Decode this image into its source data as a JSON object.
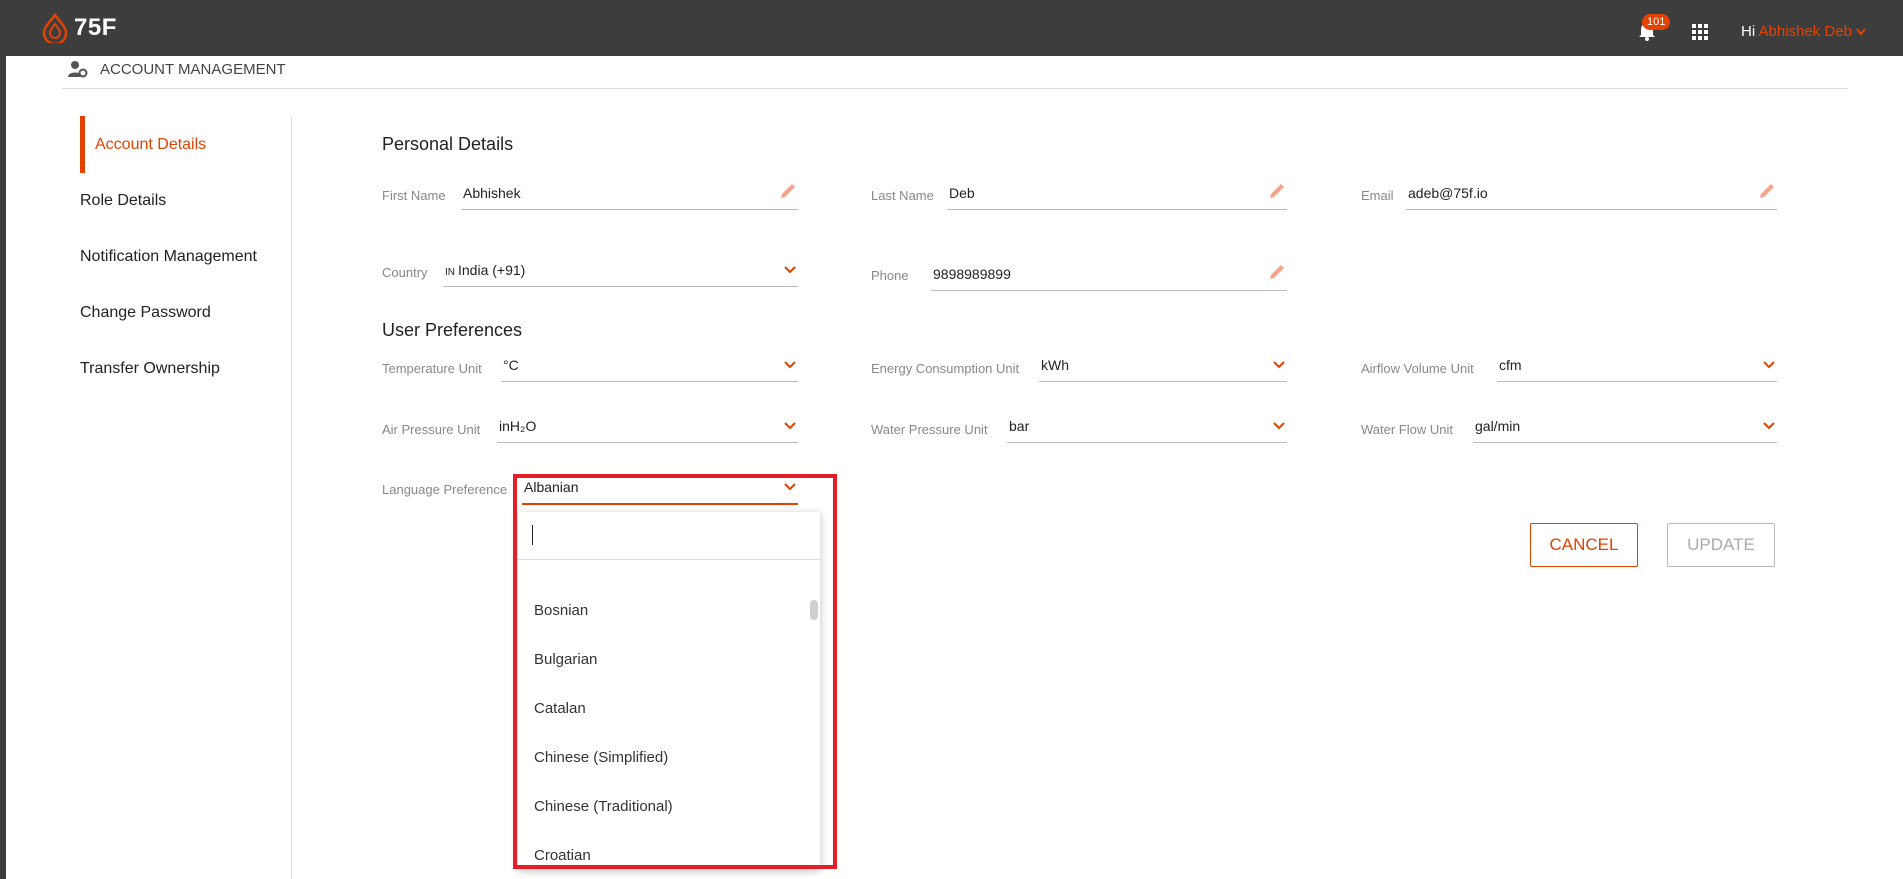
{
  "app": {
    "logo_text": "75F"
  },
  "topbar": {
    "notification_count": "101",
    "greeting": "Hi",
    "user_name": "Abhishek Deb"
  },
  "page": {
    "section_title": "ACCOUNT MANAGEMENT"
  },
  "sidebar": {
    "items": [
      {
        "label": "Account Details",
        "active": true
      },
      {
        "label": "Role Details"
      },
      {
        "label": "Notification Management"
      },
      {
        "label": "Change Password"
      },
      {
        "label": "Transfer Ownership"
      }
    ]
  },
  "personal": {
    "heading": "Personal Details",
    "first_name": {
      "label": "First Name",
      "value": "Abhishek"
    },
    "last_name": {
      "label": "Last Name",
      "value": "Deb"
    },
    "email": {
      "label": "Email",
      "value": "adeb@75f.io"
    },
    "country": {
      "label": "Country",
      "code": "IN",
      "value": "India (+91)"
    },
    "phone": {
      "label": "Phone",
      "value": "9898989899"
    }
  },
  "preferences": {
    "heading": "User Preferences",
    "temperature": {
      "label": "Temperature Unit",
      "value": "°C"
    },
    "energy": {
      "label": "Energy Consumption Unit",
      "value": "kWh"
    },
    "airflow": {
      "label": "Airflow Volume Unit",
      "value": "cfm"
    },
    "air_pressure": {
      "label": "Air Pressure Unit",
      "value": "inH₂O"
    },
    "water_pressure": {
      "label": "Water Pressure Unit",
      "value": "bar"
    },
    "water_flow": {
      "label": "Water Flow Unit",
      "value": "gal/min"
    },
    "language": {
      "label": "Language Preference",
      "value": "Albanian"
    }
  },
  "language_dropdown": {
    "search_value": "",
    "options": [
      "Bosnian",
      "Bulgarian",
      "Catalan",
      "Chinese (Simplified)",
      "Chinese (Traditional)",
      "Croatian"
    ]
  },
  "actions": {
    "cancel_label": "CANCEL",
    "update_label": "UPDATE"
  },
  "colors": {
    "accent": "#e24301",
    "topbar": "#3d3d3d",
    "highlight": "#e41e26"
  }
}
